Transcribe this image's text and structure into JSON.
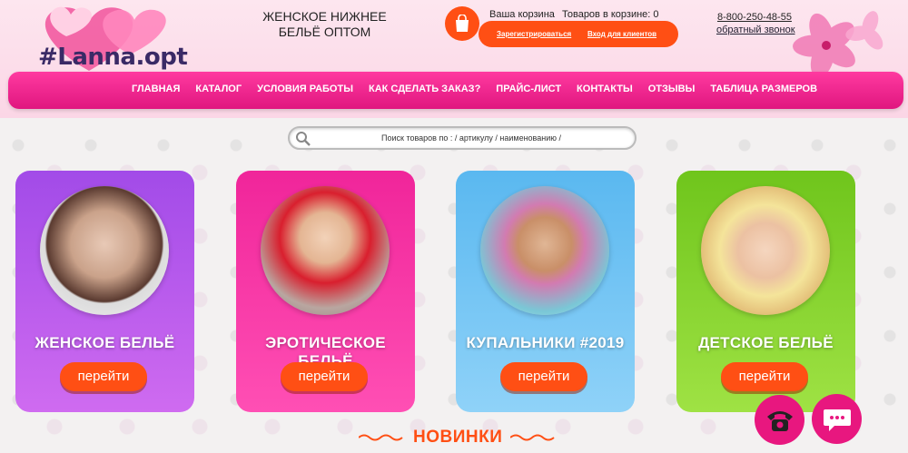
{
  "header": {
    "logo_text": "#Lanna.opt",
    "tagline_line1": "ЖЕНСКОЕ НИЖНЕЕ",
    "tagline_line2": "БЕЛЬЁ ОПТОМ",
    "cart_title": "Ваша корзина",
    "cart_count": "Товаров в корзине: 0",
    "register_label": "Зарегистрироваться",
    "login_label": "Вход для клиентов",
    "phone": "8-800-250-48-55",
    "callback_label": "обратный звонок"
  },
  "nav": {
    "items": [
      "ГЛАВНАЯ",
      "КАТАЛОГ",
      "УСЛОВИЯ РАБОТЫ",
      "КАК СДЕЛАТЬ ЗАКАЗ?",
      "ПРАЙС-ЛИСТ",
      "КОНТАКТЫ",
      "ОТЗЫВЫ",
      "ТАБЛИЦА РАЗМЕРОВ"
    ]
  },
  "search": {
    "placeholder": "Поиск товаров по : / артикулу / наименованию /"
  },
  "cards": [
    {
      "title": "ЖЕНСКОЕ БЕЛЬЁ",
      "button": "перейти"
    },
    {
      "title": "ЭРОТИЧЕСКОЕ БЕЛЬЁ",
      "button": "перейти"
    },
    {
      "title": "КУПАЛЬНИКИ #2019",
      "button": "перейти"
    },
    {
      "title": "ДЕТСКОЕ БЕЛЬЁ",
      "button": "перейти"
    }
  ],
  "section": {
    "novinki": "НОВИНКИ"
  },
  "colors": {
    "accent": "#ff4f14",
    "nav": "#e8177f"
  },
  "icons": [
    "cart-icon",
    "search-icon",
    "phone-icon",
    "chat-icon",
    "flower-icon",
    "heart-logo-icon"
  ]
}
